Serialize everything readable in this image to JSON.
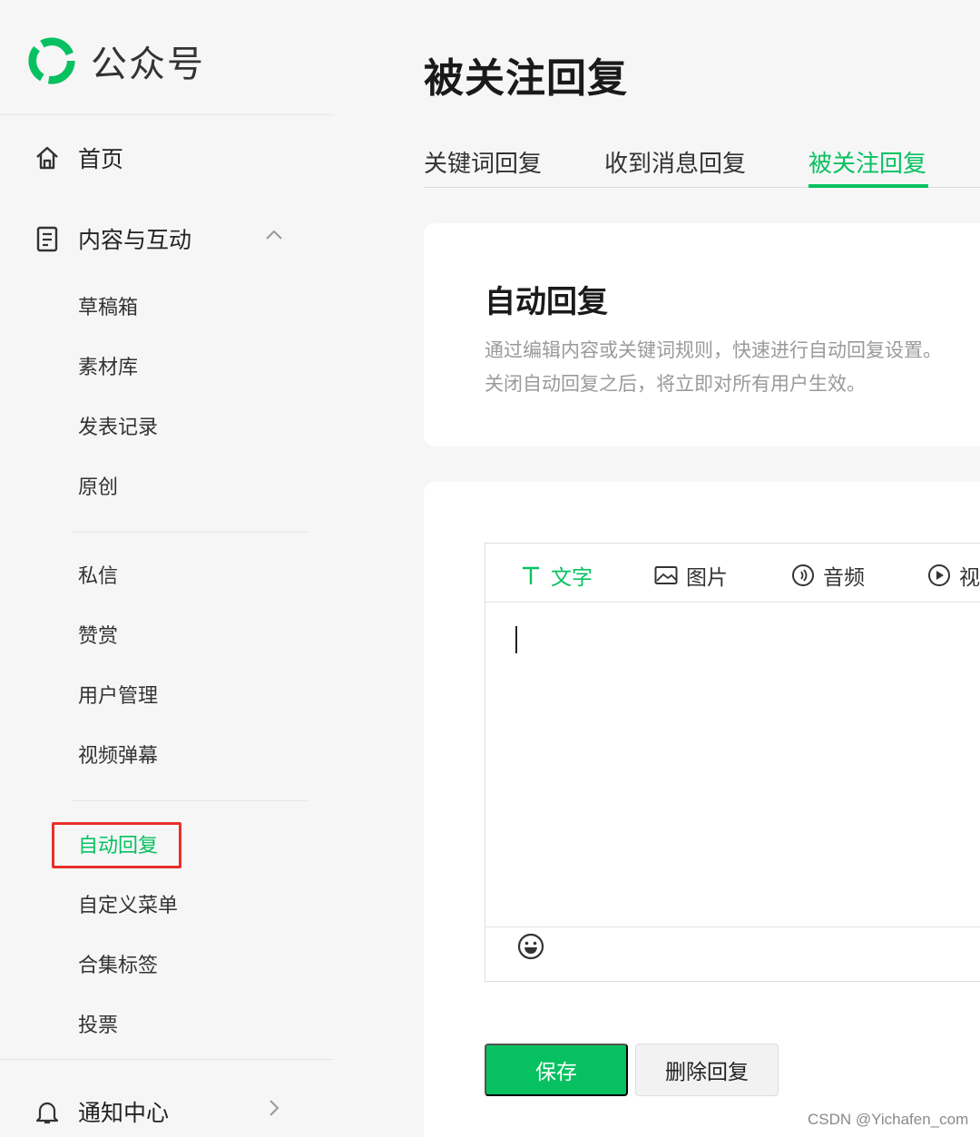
{
  "brand": {
    "name": "公众号"
  },
  "sidebar": {
    "home": {
      "label": "首页",
      "icon": "home-icon"
    },
    "content_section": {
      "label": "内容与互动",
      "icon": "document-icon",
      "expanded": true
    },
    "items": [
      {
        "label": "草稿箱"
      },
      {
        "label": "素材库"
      },
      {
        "label": "发表记录"
      },
      {
        "label": "原创"
      },
      {
        "label": "私信"
      },
      {
        "label": "赞赏"
      },
      {
        "label": "用户管理"
      },
      {
        "label": "视频弹幕"
      },
      {
        "label": "自动回复",
        "active": true
      },
      {
        "label": "自定义菜单"
      },
      {
        "label": "合集标签"
      },
      {
        "label": "投票"
      }
    ],
    "notification": {
      "label": "通知中心",
      "icon": "bell-icon"
    }
  },
  "main": {
    "title": "被关注回复",
    "tabs": [
      {
        "label": "关键词回复"
      },
      {
        "label": "收到消息回复"
      },
      {
        "label": "被关注回复",
        "active": true
      }
    ],
    "info_card": {
      "title": "自动回复",
      "desc_line1": "通过编辑内容或关键词规则，快速进行自动回复设置。",
      "desc_line2": "关闭自动回复之后，将立即对所有用户生效。"
    },
    "editor": {
      "types": [
        {
          "label": "文字",
          "icon": "text-icon",
          "active": true
        },
        {
          "label": "图片",
          "icon": "image-icon"
        },
        {
          "label": "音频",
          "icon": "audio-icon"
        },
        {
          "label": "视",
          "icon": "video-icon"
        }
      ],
      "content": "",
      "emoji_icon": "emoji-icon"
    },
    "buttons": {
      "save": "保存",
      "delete": "删除回复"
    }
  },
  "watermark": "CSDN @Yichafen_com",
  "colors": {
    "accent": "#07c160",
    "highlight_box": "#e8302a",
    "background": "#f6f6f7"
  }
}
